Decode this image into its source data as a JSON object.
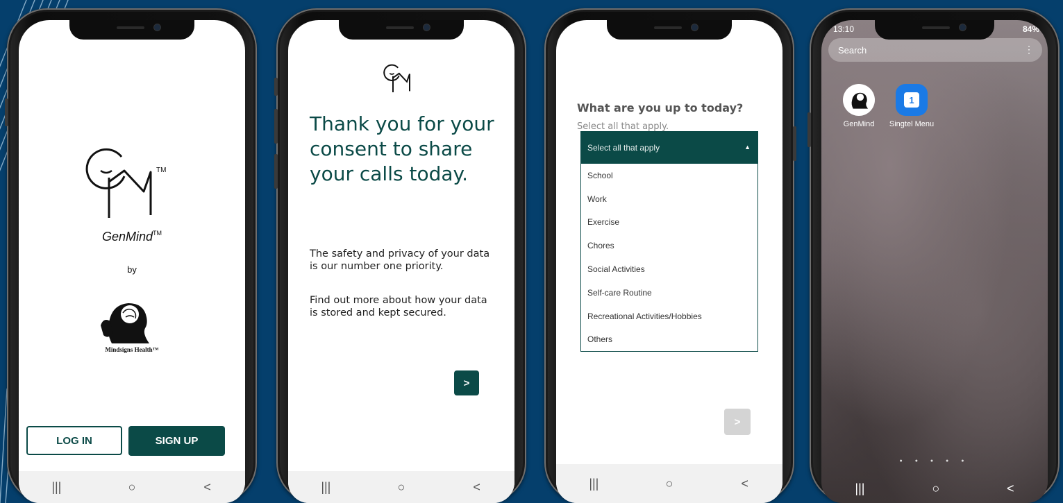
{
  "screen1": {
    "app_name": "GenMind",
    "tm": "TM",
    "by": "by",
    "brand": "Mindsigns Health™",
    "login_label": "LOG IN",
    "signup_label": "SIGN UP"
  },
  "screen2": {
    "heading": "Thank you for your consent to share your calls today.",
    "paragraph1": "The safety and privacy of your data is our number one priority.",
    "paragraph2": "Find out more about how your data is stored and kept secured.",
    "next_label": ">"
  },
  "screen3": {
    "question": "What are you up to today?",
    "hint": "Select all that apply.",
    "dropdown_label": "Select all that apply",
    "options": [
      "School",
      "Work",
      "Exercise",
      "Chores",
      "Social Activities",
      "Self-care Routine",
      "Recreational Activities/Hobbies",
      "Others"
    ],
    "next_label": ">"
  },
  "screen4": {
    "time": "13:10",
    "battery": "84%",
    "search_label": "Search",
    "apps": [
      "GenMind",
      "Singtel Menu"
    ]
  },
  "nav": {
    "recent": "|||",
    "home": "○",
    "back": "<"
  },
  "colors": {
    "primary": "#0b4a47",
    "background": "#053f6c",
    "disabled": "#d4d4d4"
  }
}
